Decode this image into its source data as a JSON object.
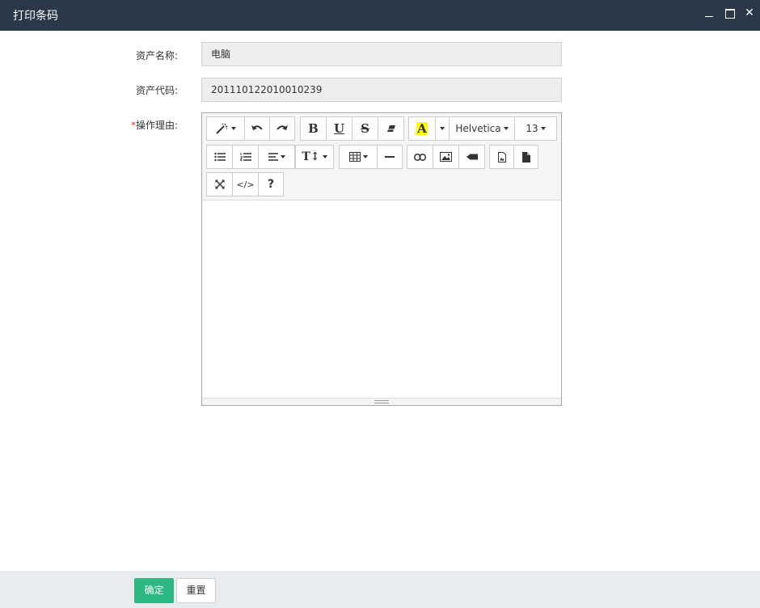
{
  "window": {
    "title": "打印条码",
    "controls": [
      "minimize-icon",
      "maximize-icon",
      "close-icon"
    ],
    "close_glyph": "✕"
  },
  "form": {
    "asset_name": {
      "label": "资产名称:",
      "value": "电脑"
    },
    "asset_code": {
      "label": "资产代码:",
      "value": "201110122010010239"
    },
    "reason": {
      "required_mark": "*",
      "label": "操作理由:",
      "value": ""
    }
  },
  "editor": {
    "font_family": "Helvetica",
    "font_size": "13",
    "bold_glyph": "B",
    "underline_glyph": "U",
    "strike_glyph": "S",
    "color_glyph": "A",
    "help_glyph": "?",
    "code_glyph": "</>",
    "toolbar_icons": [
      "magic-icon",
      "undo-icon",
      "redo-icon",
      "bold-icon",
      "underline-icon",
      "strikethrough-icon",
      "eraser-icon",
      "font-color-icon",
      "unordered-list-icon",
      "ordered-list-icon",
      "align-icon",
      "line-height-icon",
      "table-icon",
      "horizontal-rule-icon",
      "link-icon",
      "picture-icon",
      "video-icon",
      "file-image-icon",
      "file-icon",
      "fullscreen-icon",
      "code-view-icon",
      "help-icon"
    ]
  },
  "footer": {
    "confirm_label": "确定",
    "reset_label": "重置"
  },
  "colors": {
    "titlebar": "#2a3849",
    "primary": "#2db883",
    "highlight": "#ffff00"
  }
}
